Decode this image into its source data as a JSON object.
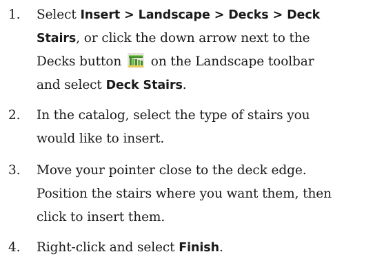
{
  "steps": [
    {
      "number": "1.",
      "lines": [
        [
          "Select ",
          "Insert > Landscape > Decks > Deck"
        ],
        [
          "Stairs",
          ", or click the down arrow next to the"
        ],
        [
          "Decks button ",
          " on the Landscape toolbar"
        ],
        [
          "and select ",
          "Deck Stairs",
          "."
        ]
      ],
      "icon": "decks-icon"
    },
    {
      "number": "2.",
      "lines": [
        [
          "In the catalog, select the type of stairs you"
        ],
        [
          "would like to insert."
        ]
      ]
    },
    {
      "number": "3.",
      "lines": [
        [
          "Move your pointer close to the deck edge."
        ],
        [
          "Position the stairs where you want them, then"
        ],
        [
          "click to insert them."
        ]
      ]
    },
    {
      "number": "4.",
      "lines": [
        [
          "Right-click and select ",
          "Finish",
          "."
        ]
      ]
    }
  ],
  "colors": {
    "text": "#1a1a1a",
    "icon_green": "#3f8d27",
    "icon_light": "#8fd06b",
    "icon_yellow": "#f2cf4e"
  }
}
